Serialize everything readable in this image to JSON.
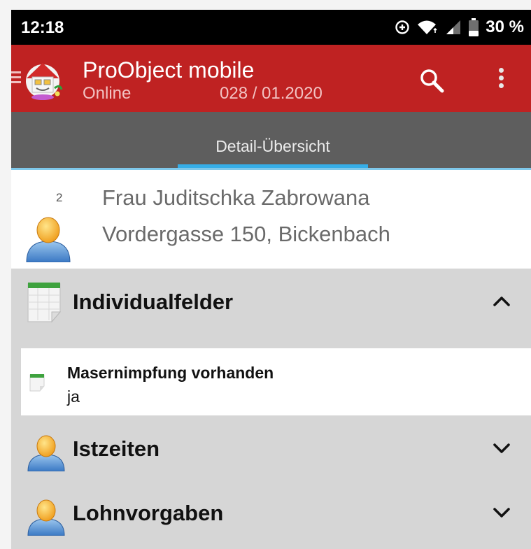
{
  "status_bar": {
    "time": "12:18",
    "battery": "30 %"
  },
  "app_bar": {
    "title": "ProObject mobile",
    "status": "Online",
    "period": "028 / 01.2020",
    "accent_color": "#bf2222"
  },
  "tabs": [
    {
      "label": "Detail-Übersicht",
      "active": true
    }
  ],
  "person": {
    "number": "2",
    "name": "Frau Juditschka Zabrowana",
    "address": "Vordergasse 150, Bickenbach"
  },
  "sections": [
    {
      "title": "Individualfelder",
      "icon": "spreadsheet-icon",
      "expanded": true,
      "fields": [
        {
          "label": "Masernimpfung vorhanden",
          "value": "ja",
          "icon": "note-icon"
        }
      ]
    },
    {
      "title": "Istzeiten",
      "icon": "person-icon",
      "expanded": false
    },
    {
      "title": "Lohnvorgaben",
      "icon": "person-icon",
      "expanded": false
    }
  ]
}
